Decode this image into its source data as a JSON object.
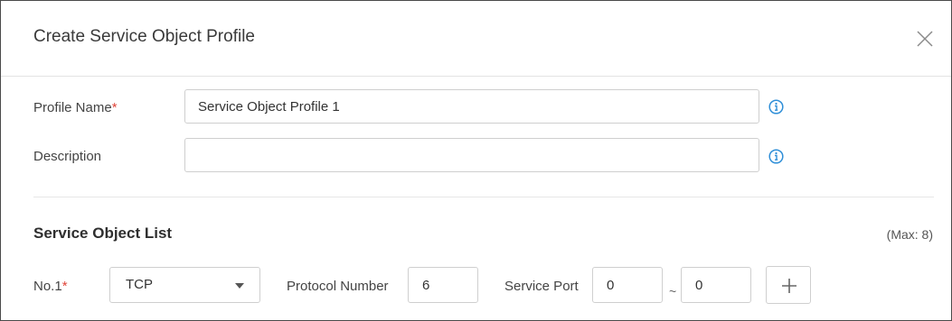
{
  "dialog": {
    "title": "Create Service Object Profile",
    "close_icon": "close-icon"
  },
  "form": {
    "profile_name": {
      "label": "Profile Name",
      "required_mark": "*",
      "value": "Service Object Profile 1",
      "info_icon": "info-icon"
    },
    "description": {
      "label": "Description",
      "value": "",
      "info_icon": "info-icon"
    }
  },
  "service_object_list": {
    "title": "Service Object List",
    "max_note": "(Max: 8)",
    "rows": [
      {
        "label": "No.1",
        "required_mark": "*",
        "protocol": "TCP",
        "protocol_dropdown_icon": "caret-down-icon",
        "protocol_number_label": "Protocol Number",
        "protocol_number": "6",
        "service_port_label": "Service Port",
        "port_start": "0",
        "range_separator": "~",
        "port_end": "0",
        "add_icon": "plus-icon"
      }
    ]
  },
  "colors": {
    "required": "#e0453a",
    "info_icon": "#2f8fd8",
    "border": "#cfcfcf",
    "dialog_border": "#4a4a4a"
  }
}
